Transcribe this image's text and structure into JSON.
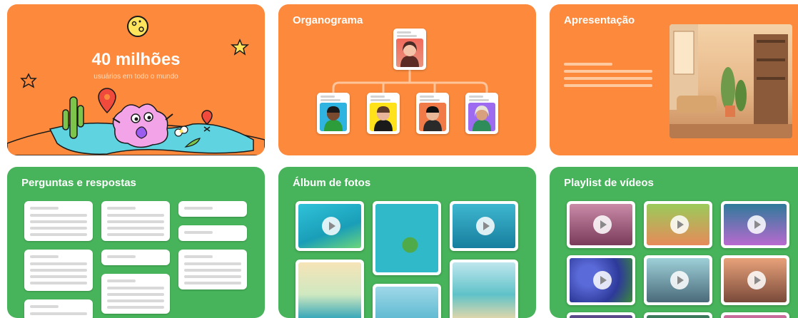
{
  "stats": {
    "number": "40 milhões",
    "subtitle": "usuários em todo o mundo"
  },
  "cards": {
    "org_title": "Organograma",
    "presentation_title": "Apresentação",
    "qa_title": "Perguntas e respostas",
    "album_title": "Álbum de fotos",
    "playlist_title": "Playlist de vídeos"
  },
  "colors": {
    "orange": "#FD8A3C",
    "green": "#47B35A"
  }
}
